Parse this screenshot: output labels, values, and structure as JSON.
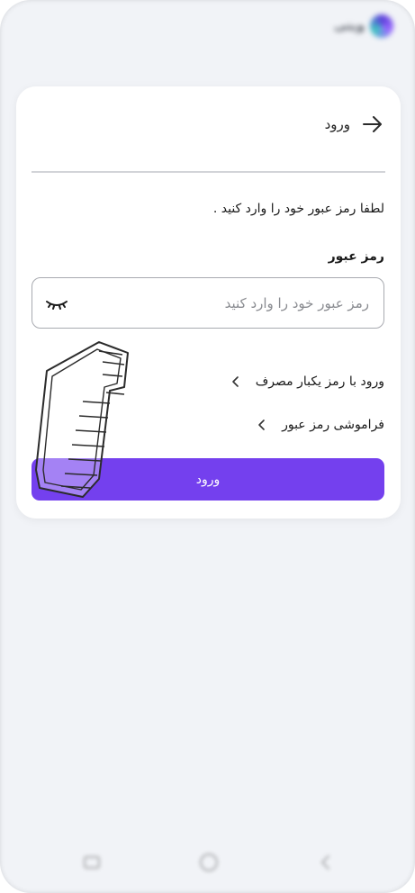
{
  "status_bar": {
    "brand_name": "ویتی"
  },
  "header": {
    "title": "ورود"
  },
  "prompt_text": "لطفا رمز عبور خود را وارد کنید .",
  "password_field": {
    "label": "رمز عبور",
    "placeholder": "رمز عبور خود را وارد کنید",
    "value": ""
  },
  "links": {
    "otp_login": "ورود با رمز یکبار مصرف",
    "forgot_password": "فراموشی رمز عبور"
  },
  "primary_button": {
    "label": "ورود"
  },
  "colors": {
    "accent": "#7440ee",
    "background": "#f1f3f7",
    "card": "#ffffff"
  },
  "icons": {
    "back": "arrow-right-icon",
    "password_visibility": "eye-closed-icon",
    "link_chevron": "chevron-left-icon"
  }
}
